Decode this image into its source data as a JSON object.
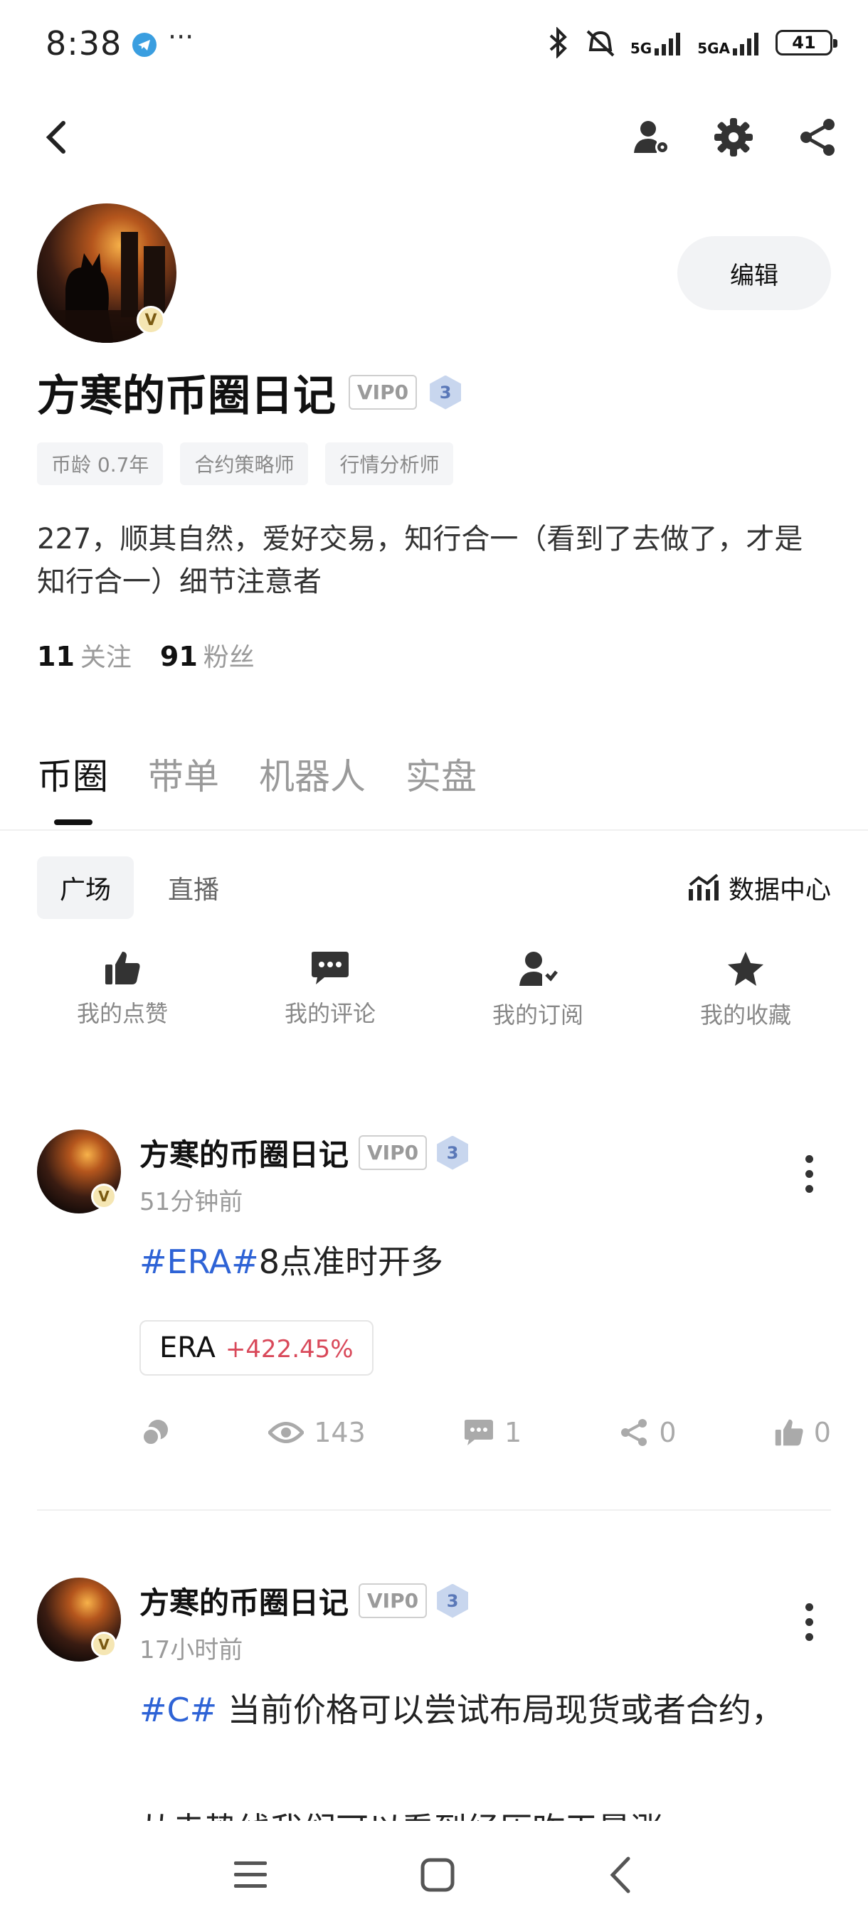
{
  "status_bar": {
    "time": "8:38",
    "dots": "···",
    "net1": "5G",
    "net2": "5GA",
    "battery": "41"
  },
  "profile": {
    "name": "方寒的币圈日记",
    "vip": "VIP0",
    "level": "3",
    "badge": "V",
    "edit_label": "编辑",
    "tags": [
      "币龄 0.7年",
      "合约策略师",
      "行情分析师"
    ],
    "bio": "227，顺其自然，爱好交易，知行合一（看到了去做了，才是知行合一）细节注意者",
    "following_count": "11",
    "following_label": "关注",
    "followers_count": "91",
    "followers_label": "粉丝"
  },
  "tabs": [
    "币圈",
    "带单",
    "机器人",
    "实盘"
  ],
  "subtabs": [
    "广场",
    "直播"
  ],
  "data_center_label": "数据中心",
  "quick_actions": [
    {
      "label": "我的点赞",
      "icon": "thumbs-up-icon"
    },
    {
      "label": "我的评论",
      "icon": "comment-icon"
    },
    {
      "label": "我的订阅",
      "icon": "subscribe-icon"
    },
    {
      "label": "我的收藏",
      "icon": "star-icon"
    }
  ],
  "posts": [
    {
      "author": "方寒的币圈日记",
      "vip": "VIP0",
      "level": "3",
      "time": "51分钟前",
      "hashtag": "#ERA#",
      "text": "8点准时开多",
      "coin": "ERA",
      "coin_change": "+422.45%",
      "views": "143",
      "comments": "1",
      "shares": "0",
      "likes": "0"
    },
    {
      "author": "方寒的币圈日记",
      "vip": "VIP0",
      "level": "3",
      "time": "17小时前",
      "hashtag": "#C#",
      "text": " 当前价格可以尝试布局现货或者合约，",
      "text2": "从走势线我们可以看到经历昨天暴涨"
    }
  ],
  "colors": {
    "accent": "#2e63d6",
    "gain": "#d9495a"
  }
}
